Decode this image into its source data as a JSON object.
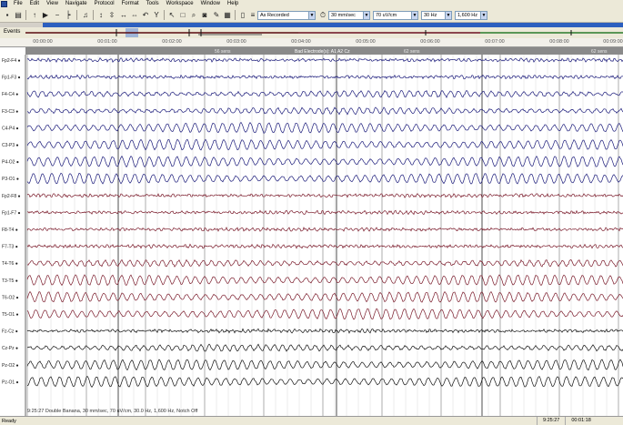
{
  "menu": [
    "File",
    "Edit",
    "View",
    "Navigate",
    "Protocol",
    "Format",
    "Tools",
    "Workspace",
    "Window",
    "Help"
  ],
  "toolbar": {
    "montage_select": "As Recorded",
    "timebase_select": "30 mm/sec",
    "sensitivity_select": "70 uV/cm",
    "lowfreq_select": "30 Hz",
    "highfreq_select": "1,600 Hz"
  },
  "events": {
    "label": "Events"
  },
  "time_axis": {
    "ticks": [
      "00:00:00",
      "00:01:00",
      "00:02:00",
      "00:03:00",
      "00:04:00",
      "00:05:00",
      "00:06:00",
      "00:07:00",
      "00:08:00",
      "00:09:00"
    ]
  },
  "annotations": {
    "epoch_left": "56 sens",
    "center": "Bad Electrode(s): A1 A2 Cz",
    "epoch_right": "62 sens",
    "epoch_far_right": "62 sens"
  },
  "channels": [
    {
      "label": "Fp2-F4",
      "color": "#1a1a7a",
      "style": "noisy"
    },
    {
      "label": "Fp1-F3",
      "color": "#1a1a7a",
      "style": "noisy"
    },
    {
      "label": "F4-C4",
      "color": "#1a1a7a",
      "style": "mixed"
    },
    {
      "label": "F3-C3",
      "color": "#1a1a7a",
      "style": "mixed"
    },
    {
      "label": "C4-P4",
      "color": "#1a1a7a",
      "style": "alpha"
    },
    {
      "label": "C3-P3",
      "color": "#1a1a7a",
      "style": "alpha"
    },
    {
      "label": "P4-O2",
      "color": "#1a1a7a",
      "style": "alpha"
    },
    {
      "label": "P3-O1",
      "color": "#1a1a7a",
      "style": "alpha"
    },
    {
      "label": "Fp2-F8",
      "color": "#7a1a2a",
      "style": "noisy"
    },
    {
      "label": "Fp1-F7",
      "color": "#7a1a2a",
      "style": "noisy"
    },
    {
      "label": "F8-T4",
      "color": "#7a1a2a",
      "style": "noisy"
    },
    {
      "label": "F7-T3",
      "color": "#7a1a2a",
      "style": "noisy"
    },
    {
      "label": "T4-T6",
      "color": "#7a1a2a",
      "style": "mixed"
    },
    {
      "label": "T3-T5",
      "color": "#7a1a2a",
      "style": "alpha"
    },
    {
      "label": "T6-O2",
      "color": "#7a1a2a",
      "style": "alpha"
    },
    {
      "label": "T5-O1",
      "color": "#7a1a2a",
      "style": "alpha"
    },
    {
      "label": "Fz-Cz",
      "color": "#111111",
      "style": "noisy"
    },
    {
      "label": "Cz-Pz",
      "color": "#111111",
      "style": "mixed"
    },
    {
      "label": "Pz-O2",
      "color": "#111111",
      "style": "alpha"
    },
    {
      "label": "Pz-O1",
      "color": "#111111",
      "style": "alpha"
    }
  ],
  "status": {
    "left": "9:25:27 Double Banana, 30 mm/sec, 70 uV/cm, 30.0 Hz, 1,600 Hz, Notch Off",
    "ready": "Ready",
    "time1": "9:25:27",
    "time2": "00:01:18"
  },
  "colors": {
    "progress": "#2c5fbf",
    "blue_trace": "#1a1a7a",
    "red_trace": "#7a1a2a",
    "black_trace": "#111111"
  }
}
